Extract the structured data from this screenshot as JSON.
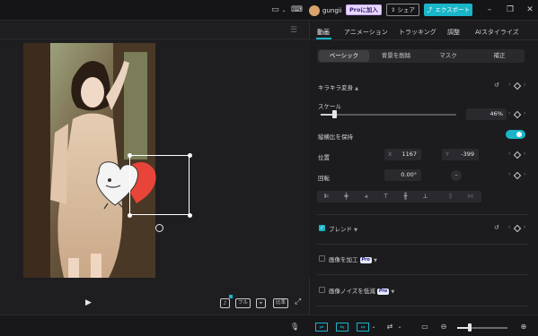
{
  "topbar": {
    "username": "gungii",
    "pro_join_label": "Proに加入",
    "share_label": "シェア",
    "export_label": "エクスポート"
  },
  "tabs": [
    "動画",
    "アニメーション",
    "トラッキング",
    "調整",
    "AIスタイライズ"
  ],
  "subtabs": [
    "ベーシック",
    "背景を削除",
    "マスク",
    "補正"
  ],
  "sections": {
    "transform_title": "キラキラ変身",
    "scale_label": "スケール",
    "scale_value": "46%",
    "scale_fraction": 0.1,
    "keep_ratio_label": "縦横比を保持",
    "position_label": "位置",
    "pos_x_label": "X",
    "pos_x_value": "1167",
    "pos_y_label": "Y",
    "pos_y_value": "-399",
    "rotation_label": "回転",
    "rotation_value": "0.00°",
    "blend_label": "ブレンド",
    "enhance_label": "画像を加工",
    "denoise_label": "画像ノイズを低減",
    "pro_badge": "Pro"
  },
  "player": {
    "full_label": "フル",
    "ratio_label": "比率"
  },
  "colors": {
    "accent": "#19b5c8",
    "panel_bg": "#1c1c1f",
    "player_bg": "#1e1e21"
  }
}
